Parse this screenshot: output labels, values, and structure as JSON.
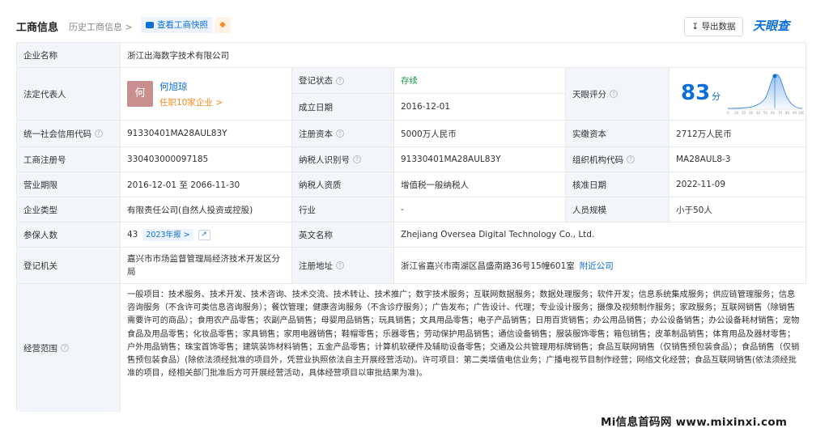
{
  "header": {
    "title": "工商信息",
    "history": "历史工商信息 >",
    "snapshot_btn": "查看工商快照",
    "bell_icon": "bell-icon",
    "export_btn": "导出数据",
    "logo": "天眼查"
  },
  "rows": {
    "company_name_label": "企业名称",
    "company_name": "浙江出海数字技术有限公司",
    "legal_rep_label": "法定代表人",
    "legal_rep_avatar": "何",
    "legal_rep_name": "何旭琼",
    "legal_rep_sub": "任职10家企业 >",
    "reg_status_label": "登记状态",
    "reg_status": "存续",
    "est_date_label": "成立日期",
    "est_date": "2016-12-01",
    "tianyan_label": "天眼评分",
    "score": "83",
    "score_unit": "分",
    "credit_code_label": "统一社会信用代码",
    "credit_code": "91330401MA28AUL83Y",
    "reg_capital_label": "注册资本",
    "reg_capital": "5000万人民币",
    "paid_capital_label": "实缴资本",
    "paid_capital": "2712万人民币",
    "biz_reg_no_label": "工商注册号",
    "biz_reg_no": "330403000097185",
    "taxpayer_id_label": "纳税人识别号",
    "taxpayer_id": "91330401MA28AUL83Y",
    "org_code_label": "组织机构代码",
    "org_code": "MA28AUL8-3",
    "biz_term_label": "营业期限",
    "biz_term": "2016-12-01 至 2066-11-30",
    "taxpayer_qual_label": "纳税人资质",
    "taxpayer_qual": "增值税一般纳税人",
    "approval_date_label": "核准日期",
    "approval_date": "2022-11-09",
    "company_type_label": "企业类型",
    "company_type": "有限责任公司(自然人投资或控股)",
    "industry_label": "行业",
    "industry": "-",
    "staff_size_label": "人员规模",
    "staff_size": "小于50人",
    "insured_label": "参保人数",
    "insured": "43",
    "insured_badge": "2023年报 >",
    "english_name_label": "英文名称",
    "english_name": "Zhejiang Oversea Digital Technology Co., Ltd.",
    "reg_authority_label": "登记机关",
    "reg_authority": "嘉兴市市场监督管理局经济技术开发区分局",
    "reg_address_label": "注册地址",
    "reg_address": "浙江省嘉兴市南湖区昌盛南路36号15幢601室",
    "nearby_link": "附近公司",
    "scope_label": "经营范围",
    "scope": "一般项目：技术服务、技术开发、技术咨询、技术交流、技术转让、技术推广；数字技术服务；互联网数据服务；数据处理服务；软件开发；信息系统集成服务；供应链管理服务；信息咨询服务（不含许可类信息咨询服务）；餐饮管理；健康咨询服务（不含诊疗服务）；广告发布；广告设计、代理；专业设计服务；摄像及视频制作服务；家政服务；互联网销售（除销售需要许可的商品）；食用农产品零售；农副产品销售；母婴用品销售；玩具销售；文具用品零售；电子产品销售；日用百货销售；办公用品销售；办公设备销售；办公设备耗材销售；宠物食品及用品零售；化妆品零售；家具销售；家用电器销售；鞋帽零售；乐器零售；劳动保护用品销售；通信设备销售；服装服饰零售；箱包销售；皮革制品销售；体育用品及器材零售；户外用品销售；珠宝首饰零售；建筑装饰材料销售；五金产品零售；计算机软硬件及辅助设备零售；交通及公共管理用标牌销售；食品互联网销售（仅销售预包装食品）；食品销售（仅销售预包装食品）(除依法须经批准的项目外，凭营业执照依法自主开展经营活动)。许可项目：第二类增值电信业务；广播电视节目制作经营；网络文化经营；食品互联网销售(依法须经批准的项目，经相关部门批准后方可开展经营活动，具体经营项目以审批结果为准)。"
  },
  "watermark": "Mi信息首码网 www.mixinxi.com",
  "colors": {
    "accent": "#0a6fd8",
    "status_green": "#1a9b4a",
    "orange": "#f58a1f",
    "label_bg": "#f2f5f9"
  }
}
